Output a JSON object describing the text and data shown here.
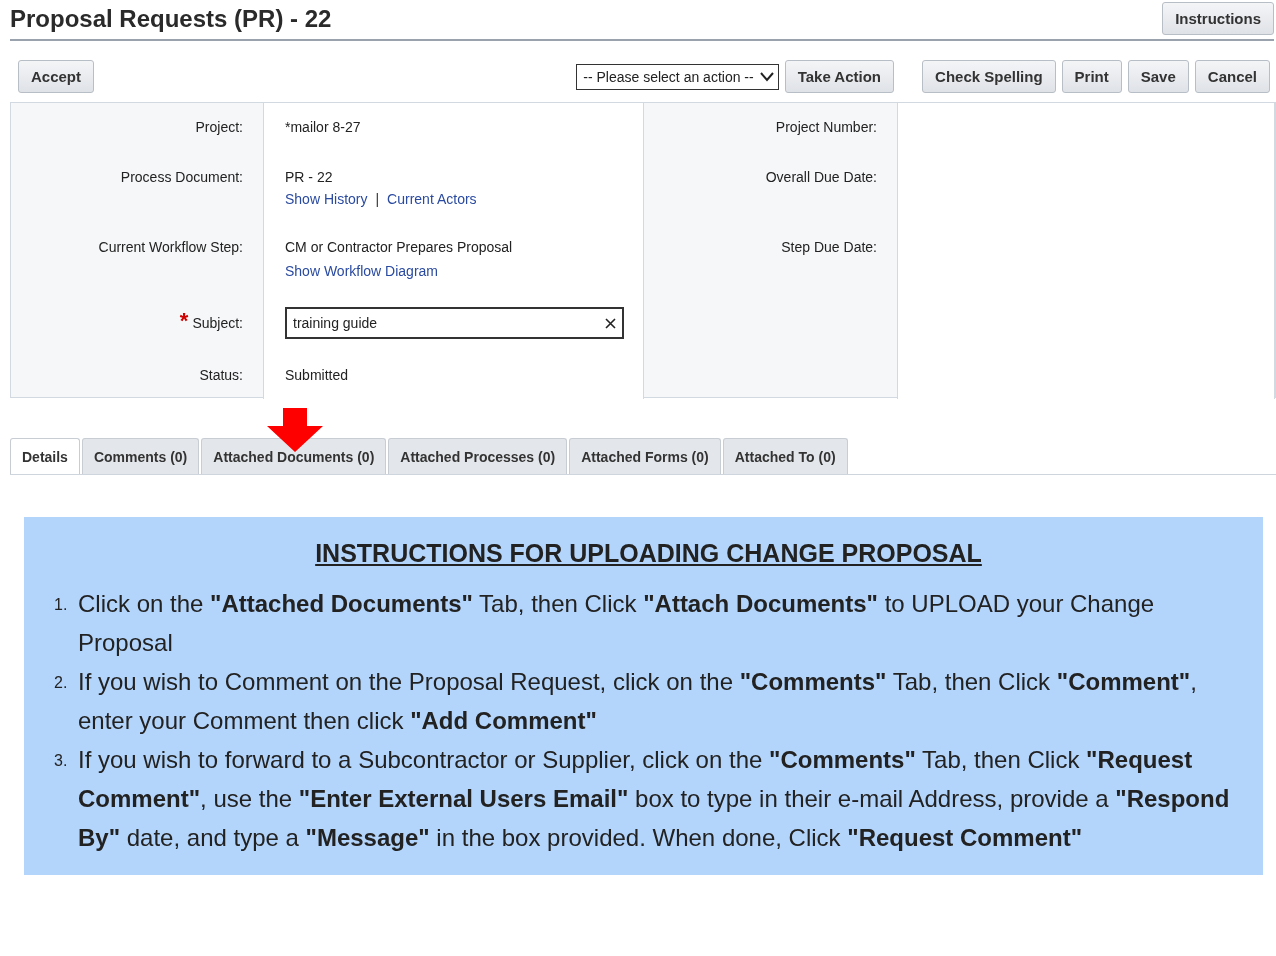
{
  "header": {
    "title": "Proposal Requests (PR) - 22",
    "instructions_button": "Instructions"
  },
  "toolbar": {
    "left_buttons": [
      "Accept"
    ],
    "action_select": {
      "value": "-- Please select an action --"
    },
    "take_action": "Take Action",
    "buttons": [
      "Check Spelling",
      "Print",
      "Save",
      "Cancel"
    ]
  },
  "fields": [
    {
      "label": "Project:",
      "kind": "text",
      "value": "*mailor 8-27"
    },
    {
      "label": "Process Document:",
      "kind": "text",
      "value": "PR - 22",
      "links": [
        "Show History",
        "Current Actors"
      ],
      "link_separator": "|"
    },
    {
      "label": "Current Workflow Step:",
      "kind": "text",
      "value": "CM or Contractor Prepares Proposal",
      "inline_link": "Show Workflow Diagram"
    },
    {
      "label": "Subject:",
      "kind": "input",
      "required_mark": "*",
      "value": "training guide"
    },
    {
      "label": "Status:",
      "kind": "text",
      "value": "Submitted"
    }
  ],
  "right_fields": [
    {
      "label": "Project Number:"
    },
    {
      "label": "Overall Due Date:"
    },
    {
      "label": "Step Due Date:"
    }
  ],
  "tabs": [
    {
      "label": "Details",
      "selected": true,
      "pointed": false
    },
    {
      "label": "Comments (0)",
      "selected": false,
      "pointed": false
    },
    {
      "label": "Attached Documents (0)",
      "selected": false,
      "pointed": true
    },
    {
      "label": "Attached Processes (0)",
      "selected": false,
      "pointed": false
    },
    {
      "label": "Attached Forms (0)",
      "selected": false,
      "pointed": false
    },
    {
      "label": "Attached To (0)",
      "selected": false,
      "pointed": false
    }
  ],
  "instructions": {
    "title": "INSTRUCTIONS FOR UPLOADING CHANGE PROPOSAL",
    "items": [
      {
        "number": "1.",
        "text": "Click on the **\"Attached Documents\"** Tab, then Click **\"Attach Documents\"** to UPLOAD your Change Proposal"
      },
      {
        "number": "2.",
        "text": "If you wish to Comment on the Proposal Request, click on the **\"Comments\"** Tab, then Click **\"Comment\"**, enter your Comment then click **\"Add Comment\"**"
      },
      {
        "number": "3.",
        "text": "If you wish to forward to a Subcontractor or Supplier, click on the **\"Comments\"** Tab, then Click **\"Request Comment\"**, use the **\"Enter External Users Email\"** box to type in their e-mail Address, provide a **\"Respond By\"** date, and type a **\"Message\"** in the box provided.  When done, Click **\"Request Comment\"**"
      }
    ]
  }
}
